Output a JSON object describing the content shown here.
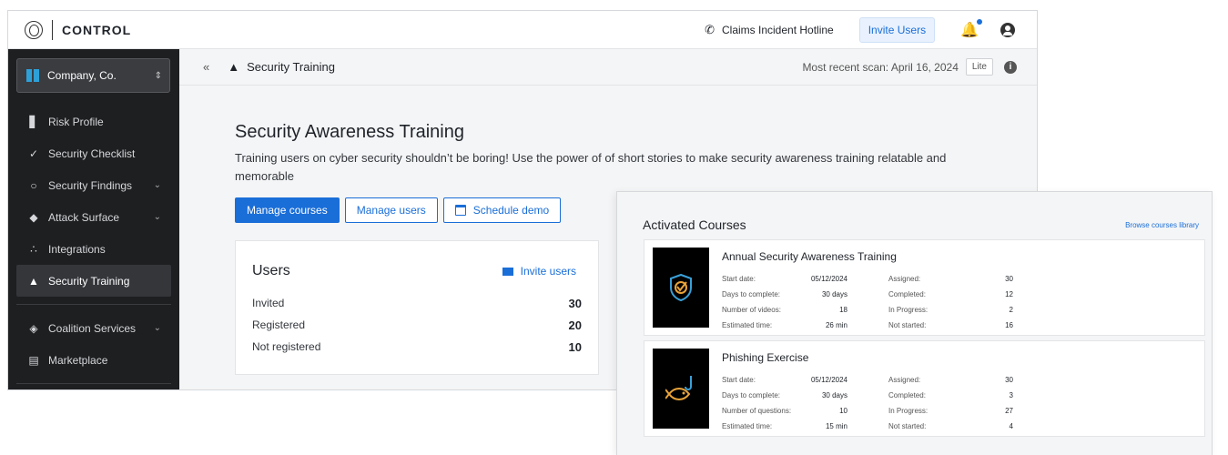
{
  "topbar": {
    "brand": "CONTROL",
    "hotline": "Claims Incident Hotline",
    "invite_users": "Invite Users"
  },
  "sidebar": {
    "company": "Company, Co.",
    "items": [
      {
        "label": "Risk Profile",
        "icon": "bar-chart-icon"
      },
      {
        "label": "Security Checklist",
        "icon": "check-circle-icon"
      },
      {
        "label": "Security Findings",
        "icon": "target-icon"
      },
      {
        "label": "Attack Surface",
        "icon": "shield-icon"
      },
      {
        "label": "Integrations",
        "icon": "plug-icon"
      },
      {
        "label": "Security Training",
        "icon": "graduation-cap-icon"
      },
      {
        "label": "Coalition Services",
        "icon": "layers-icon"
      },
      {
        "label": "Marketplace",
        "icon": "store-icon"
      }
    ]
  },
  "subheader": {
    "title": "Security Training",
    "scan": "Most recent scan: April 16, 2024",
    "badge": "Lite"
  },
  "hero": {
    "title": "Security Awareness Training",
    "description": "Training users on cyber security shouldn’t be boring! Use the power of of short stories to make security awareness training relatable and memorable"
  },
  "actions": {
    "manage_courses": "Manage courses",
    "manage_users": "Manage users",
    "schedule_demo": "Schedule demo"
  },
  "users": {
    "title": "Users",
    "invite": "Invite users",
    "rows": [
      {
        "label": "Invited",
        "value": "30"
      },
      {
        "label": "Registered",
        "value": "20"
      },
      {
        "label": "Not registered",
        "value": "10"
      }
    ]
  },
  "courses": {
    "title": "Activated Courses",
    "browse": "Browse courses library",
    "items": [
      {
        "name": "Annual Security Awareness Training",
        "left": [
          {
            "label": "Start date:",
            "value": "05/12/2024"
          },
          {
            "label": "Days to complete:",
            "value": "30 days"
          },
          {
            "label": "Number of videos:",
            "value": "18"
          },
          {
            "label": "Estimated time:",
            "value": "26 min"
          }
        ],
        "right": [
          {
            "label": "Assigned:",
            "value": "30"
          },
          {
            "label": "Completed:",
            "value": "12"
          },
          {
            "label": "In Progress:",
            "value": "2"
          },
          {
            "label": "Not started:",
            "value": "16"
          }
        ]
      },
      {
        "name": "Phishing Exercise",
        "left": [
          {
            "label": "Start date:",
            "value": "05/12/2024"
          },
          {
            "label": "Days to complete:",
            "value": "30 days"
          },
          {
            "label": "Number of questions:",
            "value": "10"
          },
          {
            "label": "Estimated time:",
            "value": "15 min"
          }
        ],
        "right": [
          {
            "label": "Assigned:",
            "value": "30"
          },
          {
            "label": "Completed:",
            "value": "3"
          },
          {
            "label": "In Progress:",
            "value": "27"
          },
          {
            "label": "Not started:",
            "value": "4"
          }
        ]
      }
    ]
  },
  "colors": {
    "accent": "#1a6ed8",
    "sidebar": "#1e1f21"
  }
}
